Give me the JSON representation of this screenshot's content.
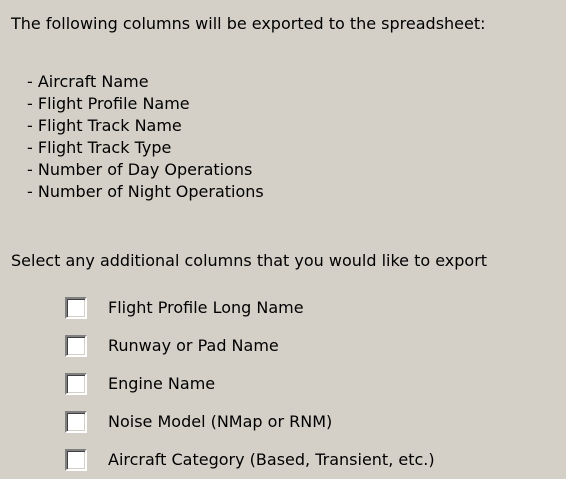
{
  "intro_text": "The following columns will be exported to the spreadsheet:",
  "exported_columns": [
    "- Aircraft Name",
    "- Flight Profile Name",
    "- Flight Track Name",
    "- Flight Track Type",
    "- Number of Day Operations",
    "- Number of Night Operations"
  ],
  "select_prompt": "Select any additional columns that you would like to export",
  "options": [
    {
      "label": "Flight Profile Long Name",
      "checked": false
    },
    {
      "label": "Runway or Pad Name",
      "checked": false
    },
    {
      "label": "Engine Name",
      "checked": false
    },
    {
      "label": "Noise Model  (NMap or RNM)",
      "checked": false
    },
    {
      "label": "Aircraft Category  (Based, Transient, etc.)",
      "checked": false
    }
  ]
}
